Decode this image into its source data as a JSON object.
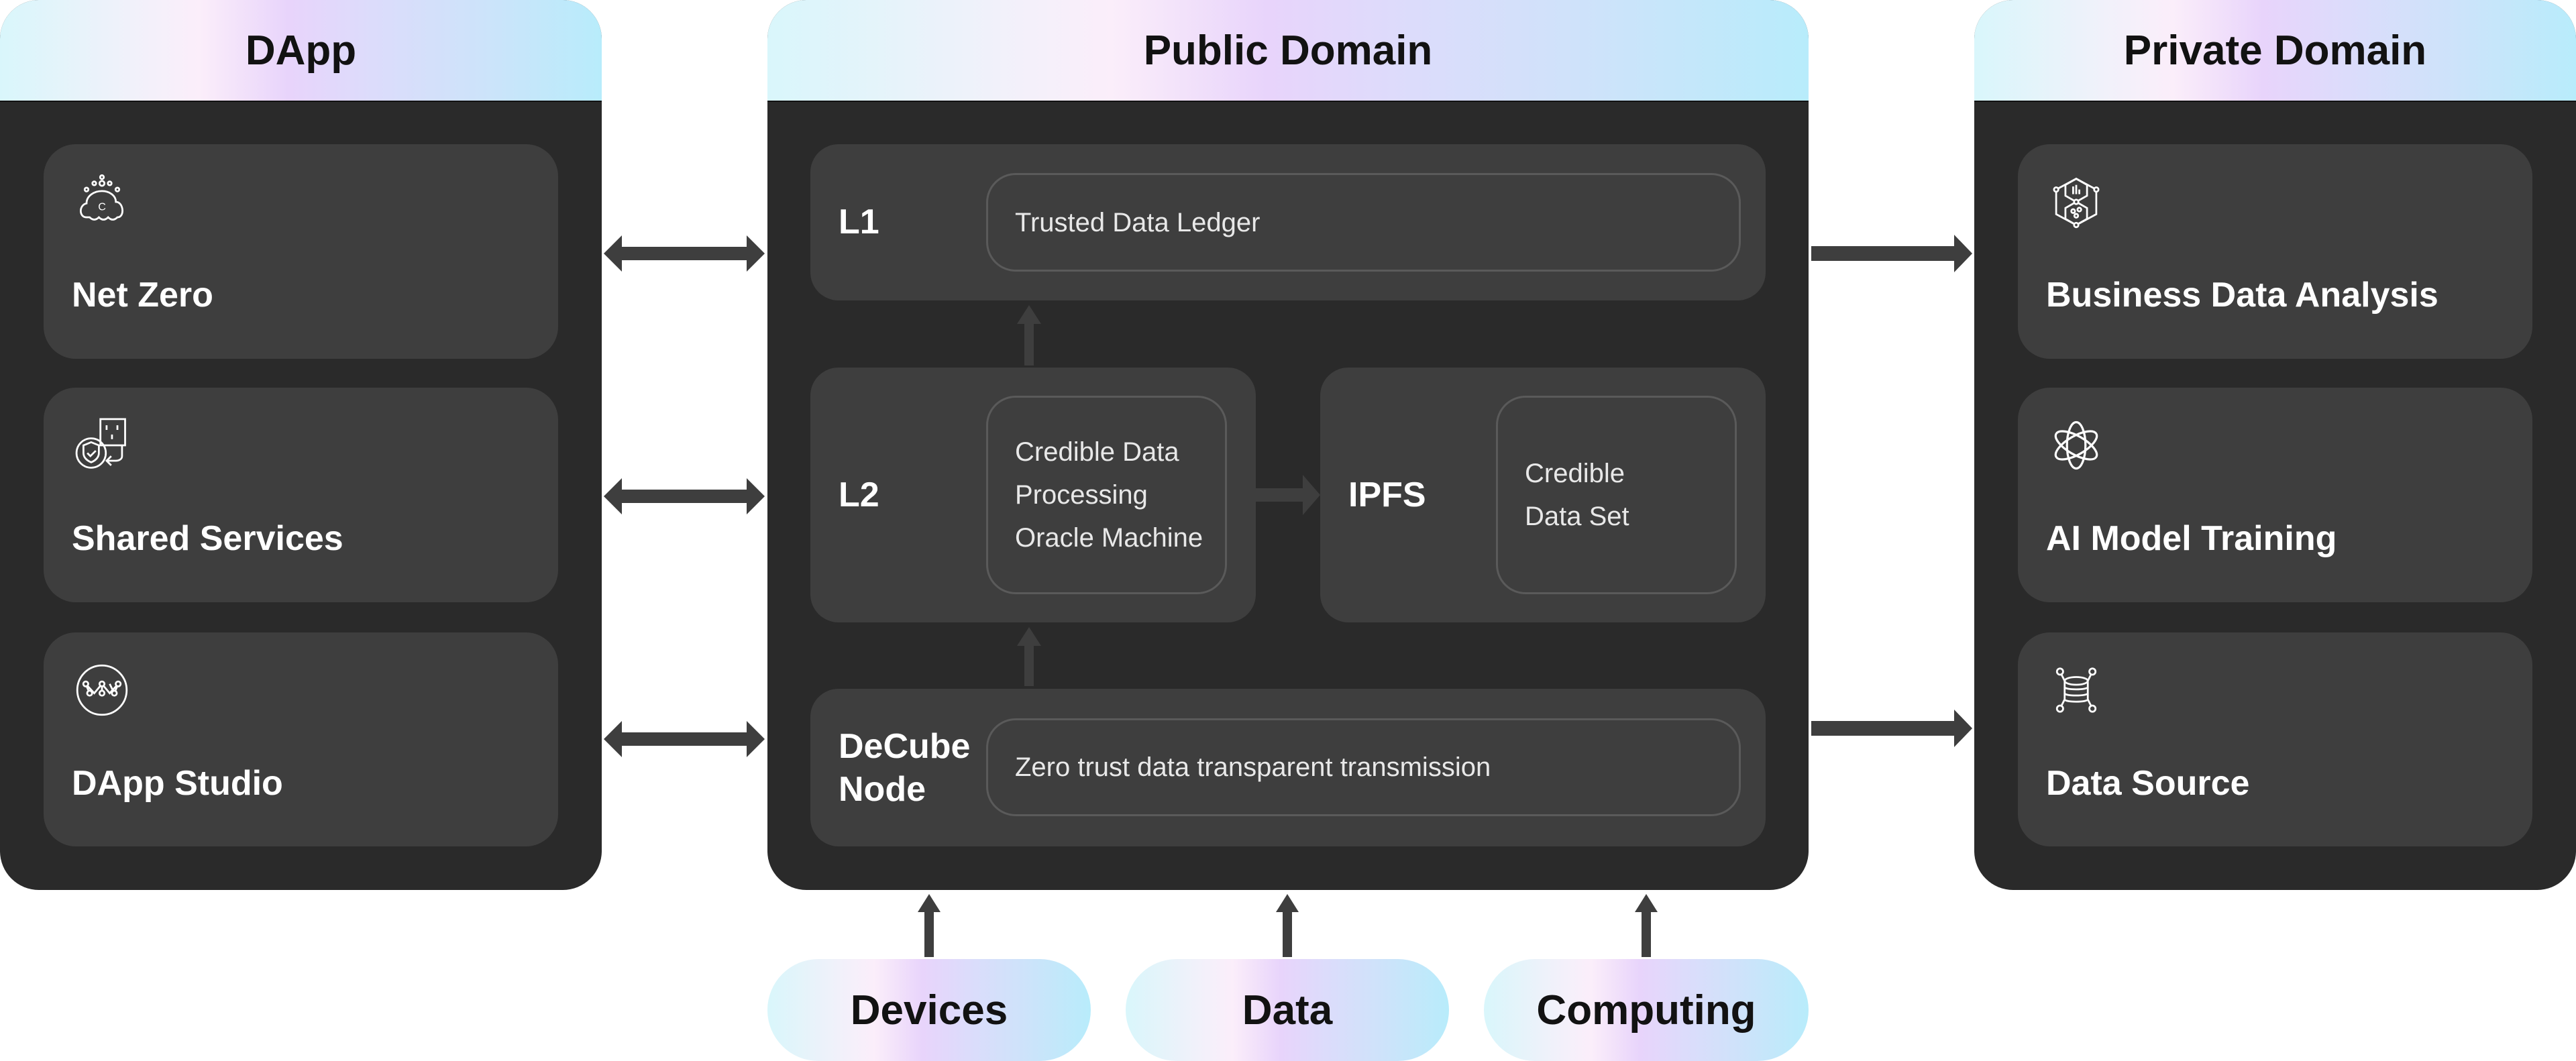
{
  "colors": {
    "panel_bg": "#2a2a2a",
    "card_bg": "#3e3e3e",
    "arrow": "#3e3e3e",
    "text_light": "#ffffff",
    "text_dark": "#121212"
  },
  "left_panel": {
    "title": "DApp",
    "items": [
      {
        "label": "Net Zero",
        "icon": "carbon-cloud-icon"
      },
      {
        "label": "Shared Services",
        "icon": "shield-plug-icon"
      },
      {
        "label": "DApp Studio",
        "icon": "network-circle-icon"
      }
    ]
  },
  "center_panel": {
    "title": "Public Domain",
    "l1": {
      "label": "L1",
      "content": "Trusted Data Ledger"
    },
    "l2": {
      "label": "L2",
      "content_lines": [
        "Credible Data",
        "Processing",
        "Oracle Machine"
      ]
    },
    "ipfs": {
      "label": "IPFS",
      "content_lines": [
        "Credible",
        "Data Set"
      ]
    },
    "decube": {
      "label_lines": [
        "DeCube",
        "Node"
      ],
      "content": "Zero trust data transparent transmission"
    }
  },
  "right_panel": {
    "title": "Private Domain",
    "items": [
      {
        "label": "Business Data Analysis",
        "icon": "data-hexagon-icon"
      },
      {
        "label": "AI Model Training",
        "icon": "atom-icon"
      },
      {
        "label": "Data Source",
        "icon": "database-network-icon"
      }
    ]
  },
  "inputs": [
    {
      "label": "Devices"
    },
    {
      "label": "Data"
    },
    {
      "label": "Computing"
    }
  ]
}
